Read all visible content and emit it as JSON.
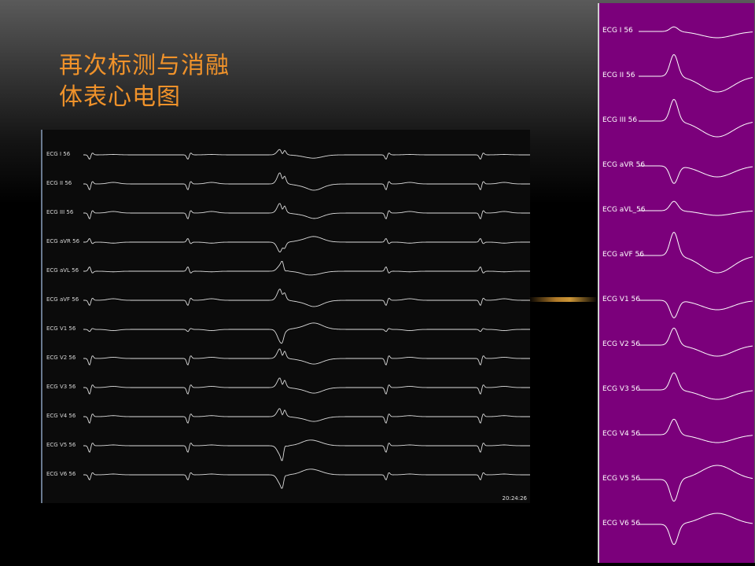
{
  "slide": {
    "title_line1": "再次标测与消融",
    "title_line2": "体表心电图",
    "title_color": "#f0922a"
  },
  "ecg_panel": {
    "leads": [
      "ECG I 56",
      "ECG II 56",
      "ECG III 56",
      "ECG aVR 56",
      "ECG aVL 56",
      "ECG aVF 56",
      "ECG V1 56",
      "ECG V2 56",
      "ECG V3 56",
      "ECG V4 56",
      "ECG V5 56",
      "ECG V6 56"
    ],
    "timestamp": "20:24:26",
    "trace_color": "#dcdcdc"
  },
  "zoom_panel": {
    "leads": [
      "ECG I 56",
      "ECG II 56",
      "ECG III 56",
      "ECG aVR 56",
      "ECG aVL_56",
      "ECG aVF 56",
      "ECG V1 56",
      "ECG V2 56",
      "ECG V3 56",
      "ECG V4 56",
      "ECG V5 56",
      "ECG V6 56"
    ],
    "background_color": "#7b007b",
    "trace_color": "#ffffff"
  }
}
